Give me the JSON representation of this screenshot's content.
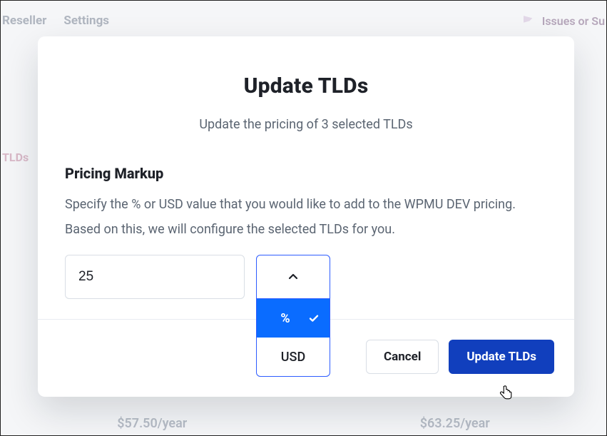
{
  "background": {
    "nav": {
      "item1": "Reseller",
      "item2": "Settings"
    },
    "support_label": "Issues or Su",
    "tab_label": "TLDs",
    "price1": "$57.50/year",
    "price2": "$63.25/year"
  },
  "modal": {
    "title": "Update TLDs",
    "subtitle": "Update the pricing of 3 selected TLDs",
    "section": {
      "heading": "Pricing Markup",
      "description": "Specify the % or USD value that you would like to add to the WPMU DEV pricing. Based on this, we will configure the selected TLDs for you."
    },
    "markup_value": "25",
    "unit": {
      "options": [
        {
          "label": "%",
          "selected": true
        },
        {
          "label": "USD",
          "selected": false
        }
      ]
    },
    "footer": {
      "cancel": "Cancel",
      "confirm": "Update TLDs"
    }
  }
}
